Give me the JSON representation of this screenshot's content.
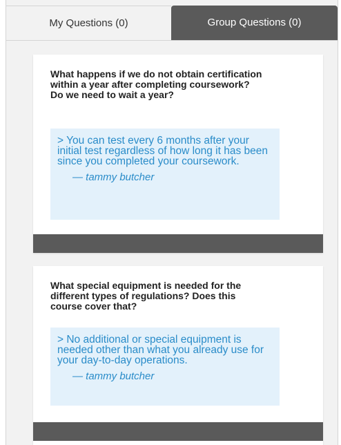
{
  "tabs": [
    {
      "label": "My Questions (0)",
      "active": false
    },
    {
      "label": "Group Questions (0)",
      "active": true
    }
  ],
  "questions": [
    {
      "question": "What happens if we do not obtain certification within a year after completing coursework? Do we need to wait a year?",
      "answer": "> You can test every 6 months after your initial test regardless of how long it has been since you completed your coursework.",
      "author": "— tammy butcher"
    },
    {
      "question": "What special equipment is needed for the different types of regulations? Does this course cover that?",
      "answer": "> No additional or special equipment is needed other than what you already use for your day-to-day operations.",
      "author": "— tammy butcher"
    }
  ],
  "colors": {
    "tab_active_bg": "#5a5a5a",
    "panel_bg": "#f2f2f2",
    "answer_bg": "#e3f1fb",
    "answer_text": "#2a8cc9",
    "card_footer": "#5a5a5a"
  }
}
